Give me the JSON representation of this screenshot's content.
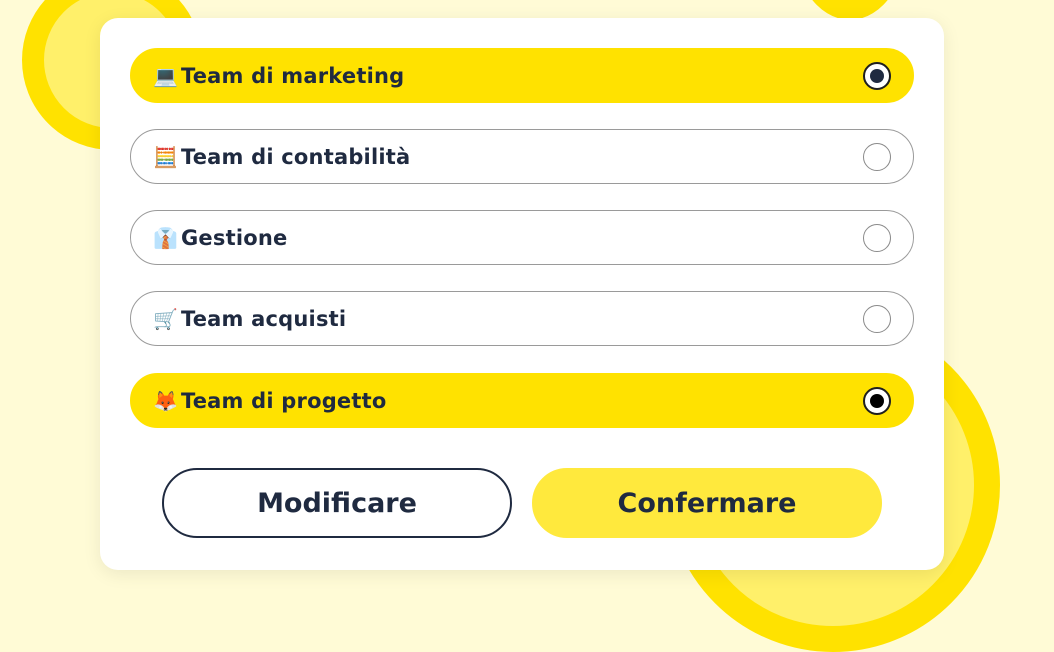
{
  "colors": {
    "background": "#fffbd6",
    "accent_yellow": "#ffe200",
    "primary_button": "#ffe93d",
    "text_dark": "#1f2a40",
    "card": "#ffffff"
  },
  "options": [
    {
      "icon": "laptop-icon",
      "emoji": "💻",
      "label": "Team di marketing",
      "selected": true
    },
    {
      "icon": "abacus-icon",
      "emoji": "🧮",
      "label": "Team di contabilità",
      "selected": false
    },
    {
      "icon": "office-worker-icon",
      "emoji": "👔",
      "label": "Gestione",
      "selected": false
    },
    {
      "icon": "shopping-cart-icon",
      "emoji": "🛒",
      "label": "Team acquisti",
      "selected": false
    },
    {
      "icon": "fox-icon",
      "emoji": "🦊",
      "label": "Team di progetto",
      "selected": true
    }
  ],
  "buttons": {
    "edit_label": "Modificare",
    "confirm_label": "Confermare"
  }
}
